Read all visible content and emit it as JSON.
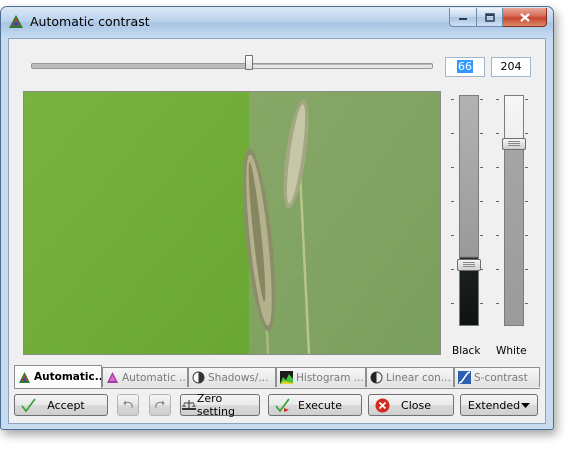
{
  "window": {
    "title": "Automatic contrast",
    "icon": "app-color-icon",
    "caption_buttons": [
      "minimize-icon",
      "maximize-icon",
      "close-icon"
    ]
  },
  "slider": {
    "value_black": "66",
    "value_white": "204"
  },
  "vertical_sliders": {
    "black_label": "Black",
    "white_label": "White"
  },
  "tabs": [
    {
      "label": "Automatic...",
      "icon": "auto-contrast-icon",
      "active": true
    },
    {
      "label": "Automatic ...",
      "icon": "auto-color-icon",
      "active": false
    },
    {
      "label": "Shadows/...",
      "icon": "shadows-icon",
      "active": false
    },
    {
      "label": "Histogram ...",
      "icon": "histogram-icon",
      "active": false
    },
    {
      "label": "Linear con...",
      "icon": "linear-contrast-icon",
      "active": false
    },
    {
      "label": "S-contrast",
      "icon": "s-curve-icon",
      "active": false
    }
  ],
  "buttons": {
    "accept": "Accept",
    "undo": "undo-icon",
    "redo": "redo-icon",
    "zero": "Zero setting",
    "execute": "Execute",
    "close": "Close",
    "extended": "Extended"
  },
  "colors": {
    "accent_selection": "#3399ff",
    "accept_check": "#3aa63a",
    "close_red": "#d32a1d"
  }
}
